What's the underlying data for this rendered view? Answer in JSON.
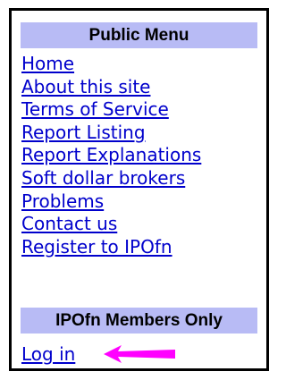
{
  "public_menu": {
    "title": "Public Menu",
    "items": [
      {
        "label": "Home"
      },
      {
        "label": "About this site"
      },
      {
        "label": "Terms of Service"
      },
      {
        "label": "Report Listing"
      },
      {
        "label": "Report Explanations"
      },
      {
        "label": "Soft dollar brokers"
      },
      {
        "label": "Problems"
      },
      {
        "label": "Contact us"
      },
      {
        "label": "Register to IPOfn"
      }
    ]
  },
  "members_menu": {
    "title": "IPOfn Members Only",
    "login_label": "Log in"
  },
  "colors": {
    "header_bg": "#b8bbf5",
    "link": "#0000cc",
    "arrow": "#ff00ff",
    "border": "#000000"
  },
  "icons": {
    "pointer": "arrow-left-icon"
  }
}
